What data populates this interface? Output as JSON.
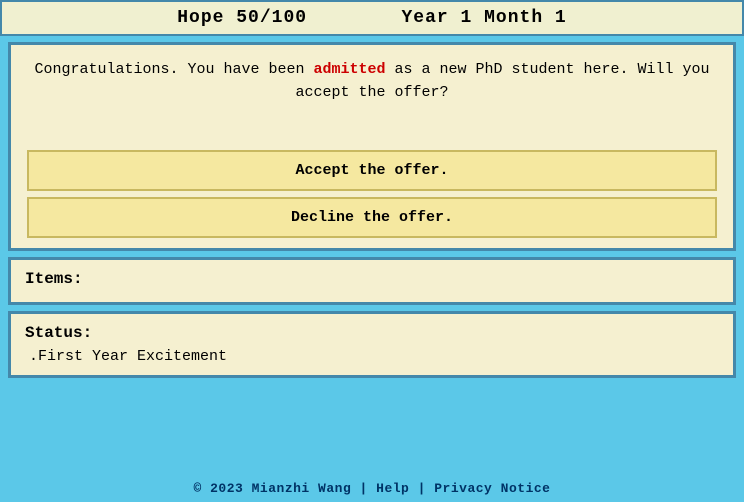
{
  "header": {
    "hope_label": "Hope 50/100",
    "year_month_label": "Year 1 Month 1"
  },
  "dialog": {
    "text_before": "Congratulations. You have been ",
    "admitted_word": "admitted",
    "text_after": " as a new PhD student here. Will you accept the offer?",
    "accept_button": "Accept the offer.",
    "decline_button": "Decline the offer."
  },
  "items": {
    "label": "Items:"
  },
  "status": {
    "label": "Status:",
    "item1": ".First Year Excitement"
  },
  "footer": {
    "copyright": "© 2023 Mianzhi Wang | Help | Privacy Notice"
  }
}
